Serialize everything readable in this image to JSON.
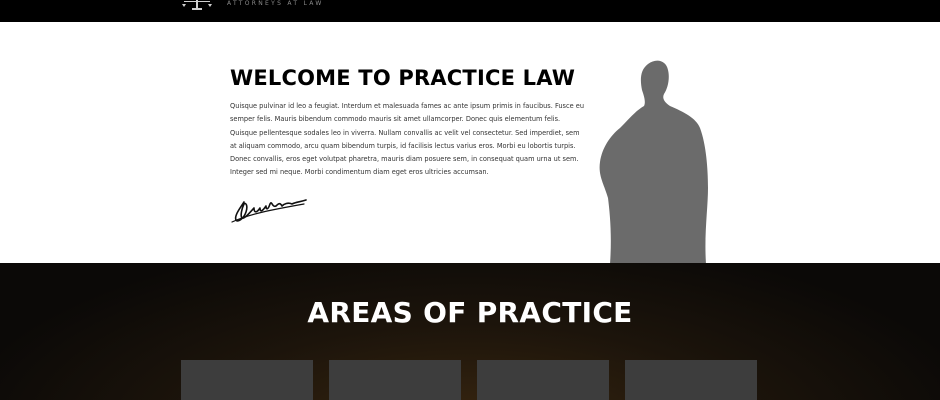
{
  "header": {
    "logo_icon": "scales-of-justice-icon",
    "tagline": "ATTORNEYS AT LAW"
  },
  "welcome": {
    "title": "WELCOME TO PRACTICE LAW",
    "body": "Quisque pulvinar id leo a feugiat. Interdum et malesuada fames ac ante ipsum primis in faucibus. Fusce eu semper felis. Mauris bibendum commodo mauris sit amet ullamcorper. Donec quis elementum felis. Quisque pellentesque sodales leo in viverra. Nullam convallis ac velit vel consectetur. Sed imperdiet, sem at aliquam commodo, arcu quam bibendum turpis, id facilisis lectus varius eros. Morbi eu lobortis turpis. Donec convallis, eros eget volutpat pharetra, mauris diam posuere sem, in consequat quam urna ut sem. Integer sed mi neque. Morbi condimentum diam eget eros ultricies accumsan.",
    "signature_icon": "handwritten-signature",
    "image": "man-silhouette"
  },
  "areas": {
    "title": "AREAS OF PRACTICE",
    "cards": [
      "",
      "",
      "",
      ""
    ]
  },
  "colors": {
    "topbar": "#000000",
    "silhouette": "#6b6b6b",
    "areas_bg": "#1c140b",
    "card": "#3d3d3d"
  }
}
